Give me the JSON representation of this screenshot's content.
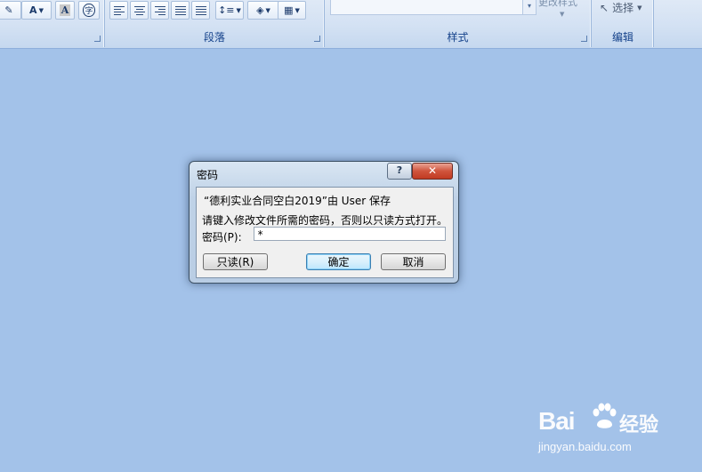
{
  "ribbon": {
    "groups": {
      "font": {
        "label": ""
      },
      "paragraph": {
        "label": "段落"
      },
      "styles": {
        "label": "样式",
        "change_styles": "更改样式"
      },
      "editing": {
        "label": "编辑",
        "select": "选择"
      }
    },
    "font_buttons": {
      "font_color_glyph": "A",
      "char_shading_glyph": "A",
      "enclosed_glyph": "字"
    }
  },
  "dialog": {
    "title": "密码",
    "help_glyph": "?",
    "close_glyph": "✕",
    "file_info": "“德利实业合同空白2019”由 User 保存",
    "instruction": "请键入修改文件所需的密码，否则以只读方式打开。",
    "password_label": "密码(P):",
    "password_value": "*",
    "buttons": {
      "read_only": "只读(R)",
      "ok": "确定",
      "cancel": "取消"
    }
  },
  "watermark": {
    "brand": "Bai",
    "brand_cn": "经验",
    "url": "jingyan.baidu.com"
  },
  "colors": {
    "workspace": "#a3c2e9",
    "ribbon": "#d3e1f3",
    "ribbon_label": "#15428b",
    "close_button": "#c13a22"
  }
}
